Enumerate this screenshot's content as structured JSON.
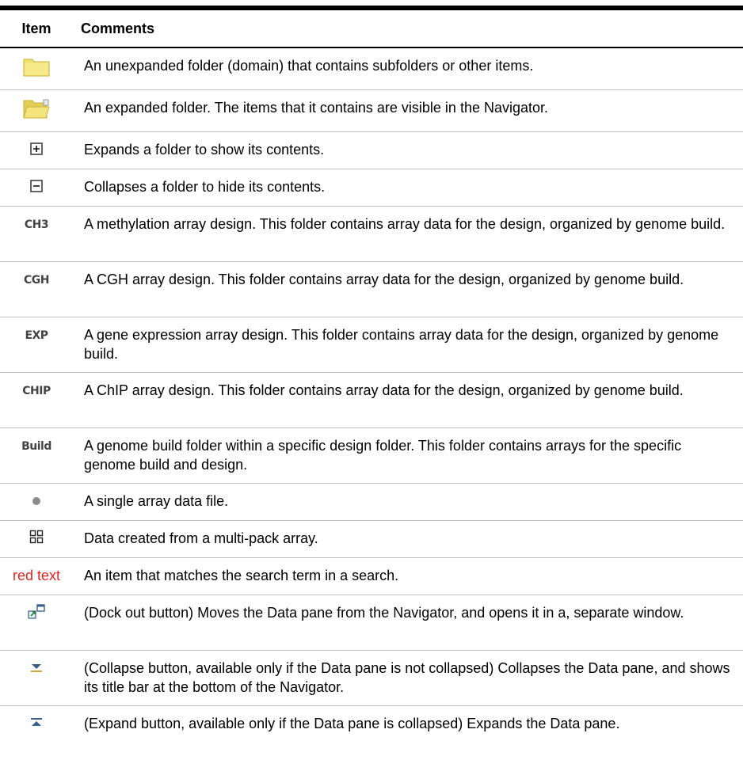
{
  "header": {
    "item": "Item",
    "comments": "Comments"
  },
  "rows": [
    {
      "icon": "folder-closed-icon",
      "comment": "An unexpanded folder (domain) that contains subfolders or other items."
    },
    {
      "icon": "folder-open-icon",
      "comment": "An expanded folder. The items that it contains are visible in the Navigator."
    },
    {
      "icon": "plus-box-icon",
      "comment": "Expands a folder to show its contents."
    },
    {
      "icon": "minus-box-icon",
      "comment": "Collapses a folder to hide its contents."
    },
    {
      "icon": "methylation-design-icon",
      "icon_text": "CH3",
      "comment": "A methylation array design. This folder contains array data for the design, organized by genome build."
    },
    {
      "icon": "cgh-design-icon",
      "icon_text": "CGH",
      "comment": "A CGH array design. This folder contains array data for the design, organized by genome build."
    },
    {
      "icon": "expression-design-icon",
      "icon_text": "EXP",
      "comment": "A gene expression array design. This folder contains array data for the design, organized by genome build."
    },
    {
      "icon": "chip-design-icon",
      "icon_text": "CHIP",
      "comment": "A ChIP array design. This folder contains array data for the design, organized by genome build."
    },
    {
      "icon": "build-folder-icon",
      "icon_text": "Build",
      "comment": "A genome build folder within a specific design folder. This folder contains arrays for the specific genome build and design."
    },
    {
      "icon": "array-file-dot-icon",
      "comment": "A single array data file."
    },
    {
      "icon": "multipack-grid-icon",
      "comment": "Data created from a multi-pack array."
    },
    {
      "icon_label": "red text",
      "icon_color": "#e8231e",
      "comment": "An item that matches the search term in a search."
    },
    {
      "icon": "dock-out-icon",
      "comment": "(Dock out button) Moves the Data pane from the Navigator, and opens it in a, separate window."
    },
    {
      "icon": "collapse-pane-icon",
      "comment": "(Collapse button, available only if the Data pane is not collapsed) Collapses the Data pane, and shows its title bar at the bottom of the Navigator."
    },
    {
      "icon": "expand-pane-icon",
      "comment": "(Expand button, available only if the Data pane is collapsed) Expands the Data pane."
    }
  ]
}
